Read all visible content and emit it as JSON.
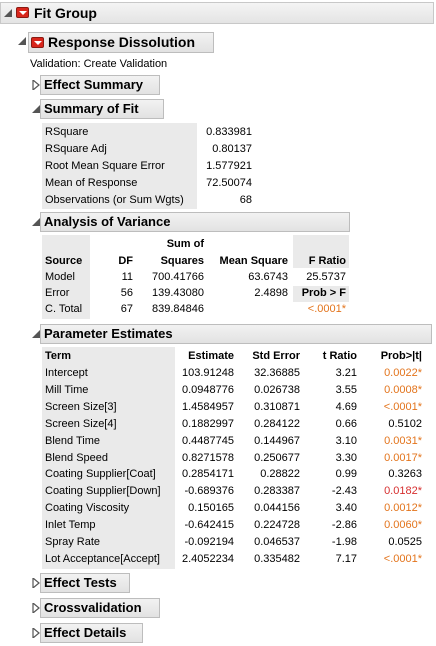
{
  "fit_group": {
    "title": "Fit Group"
  },
  "response": {
    "title": "Response Dissolution",
    "validation_note": "Validation: Create Validation"
  },
  "effect_summary": {
    "title": "Effect Summary"
  },
  "summary_of_fit": {
    "title": "Summary of Fit",
    "rows": [
      {
        "label": "RSquare",
        "value": "0.833981"
      },
      {
        "label": "RSquare Adj",
        "value": "0.80137"
      },
      {
        "label": "Root Mean Square Error",
        "value": "1.577921"
      },
      {
        "label": "Mean of Response",
        "value": "72.50074"
      },
      {
        "label": "Observations (or Sum Wgts)",
        "value": "68"
      }
    ]
  },
  "anova": {
    "title": "Analysis of Variance",
    "headers": {
      "source": "Source",
      "df": "DF",
      "ss_top": "Sum of",
      "ss_bottom": "Squares",
      "ms": "Mean Square",
      "f": "F Ratio"
    },
    "rows": [
      {
        "source": "Model",
        "df": "11",
        "ss": "700.41766",
        "ms": "63.6743",
        "f": "25.5737"
      },
      {
        "source": "Error",
        "df": "56",
        "ss": "139.43080",
        "ms": "2.4898",
        "f": "Prob > F"
      },
      {
        "source": "C. Total",
        "df": "67",
        "ss": "839.84846",
        "ms": "",
        "f": "<.0001*"
      }
    ]
  },
  "parameter_estimates": {
    "title": "Parameter Estimates",
    "headers": {
      "term": "Term",
      "estimate": "Estimate",
      "std_error": "Std Error",
      "t_ratio": "t Ratio",
      "prob": "Prob>|t|"
    },
    "rows": [
      {
        "term": "Intercept",
        "estimate": "103.91248",
        "std_error": "32.36885",
        "t_ratio": "3.21",
        "prob": "0.0022*",
        "color": "orange"
      },
      {
        "term": "Mill Time",
        "estimate": "0.0948776",
        "std_error": "0.026738",
        "t_ratio": "3.55",
        "prob": "0.0008*",
        "color": "orange"
      },
      {
        "term": "Screen Size[3]",
        "estimate": "1.4584957",
        "std_error": "0.310871",
        "t_ratio": "4.69",
        "prob": "<.0001*",
        "color": "orange"
      },
      {
        "term": "Screen Size[4]",
        "estimate": "0.1882997",
        "std_error": "0.284122",
        "t_ratio": "0.66",
        "prob": "0.5102",
        "color": "black"
      },
      {
        "term": "Blend Time",
        "estimate": "0.4487745",
        "std_error": "0.144967",
        "t_ratio": "3.10",
        "prob": "0.0031*",
        "color": "orange"
      },
      {
        "term": "Blend Speed",
        "estimate": "0.8271578",
        "std_error": "0.250677",
        "t_ratio": "3.30",
        "prob": "0.0017*",
        "color": "orange"
      },
      {
        "term": "Coating Supplier[Coat]",
        "estimate": "0.2854171",
        "std_error": "0.28822",
        "t_ratio": "0.99",
        "prob": "0.3263",
        "color": "black"
      },
      {
        "term": "Coating Supplier[Down]",
        "estimate": "-0.689376",
        "std_error": "0.283387",
        "t_ratio": "-2.43",
        "prob": "0.0182*",
        "color": "red"
      },
      {
        "term": "Coating Viscosity",
        "estimate": "0.150165",
        "std_error": "0.044156",
        "t_ratio": "3.40",
        "prob": "0.0012*",
        "color": "orange"
      },
      {
        "term": "Inlet Temp",
        "estimate": "-0.642415",
        "std_error": "0.224728",
        "t_ratio": "-2.86",
        "prob": "0.0060*",
        "color": "orange"
      },
      {
        "term": "Spray Rate",
        "estimate": "-0.092194",
        "std_error": "0.046537",
        "t_ratio": "-1.98",
        "prob": "0.0525",
        "color": "black"
      },
      {
        "term": "Lot Acceptance[Accept]",
        "estimate": "2.4052234",
        "std_error": "0.335482",
        "t_ratio": "7.17",
        "prob": "<.0001*",
        "color": "orange"
      }
    ]
  },
  "effect_tests": {
    "title": "Effect Tests"
  },
  "crossvalidation": {
    "title": "Crossvalidation"
  },
  "effect_details": {
    "title": "Effect Details"
  },
  "colors": {
    "significant_orange": "#e3741c",
    "significant_red": "#d62f2f",
    "menu_red": "#d9261c"
  }
}
